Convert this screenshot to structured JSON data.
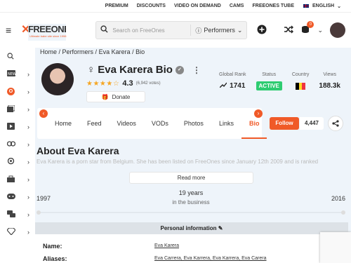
{
  "topbar": {
    "links": [
      "PREMIUM",
      "DISCOUNTS",
      "VIDEO ON DEMAND",
      "CAMS",
      "FREEONES TUBE"
    ],
    "language": "ENGLISH"
  },
  "header": {
    "logo_text": "FREEONES",
    "logo_tagline": "Ultimate babe site since 1998",
    "search_placeholder": "Search on FreeOnes",
    "search_filter": "Performers",
    "notification_count": "0"
  },
  "sidebar": {
    "items": [
      {
        "icon": "search-icon",
        "chevron": false
      },
      {
        "icon": "new-icon",
        "chevron": true
      },
      {
        "icon": "freeones-icon",
        "chevron": true
      },
      {
        "icon": "photos-icon",
        "chevron": true
      },
      {
        "icon": "videos-icon",
        "chevron": true
      },
      {
        "icon": "links-icon",
        "chevron": true
      },
      {
        "icon": "cams-icon",
        "chevron": true
      },
      {
        "icon": "shop-icon",
        "chevron": true
      },
      {
        "icon": "games-icon",
        "chevron": true
      },
      {
        "icon": "forum-icon",
        "chevron": true
      },
      {
        "icon": "diamond-icon",
        "chevron": true
      }
    ]
  },
  "breadcrumb": [
    "Home",
    "Performers",
    "Eva Karera",
    "Bio"
  ],
  "profile": {
    "name": "Eva Karera Bio",
    "rating": "4.3",
    "votes": "(6,942 votes)",
    "donate_label": "Donate",
    "stars": "★★★★☆"
  },
  "stats": {
    "global_rank_label": "Global Rank",
    "global_rank": "1741",
    "status_label": "Status",
    "status": "ACTIVE",
    "country_label": "Country",
    "views_label": "Views",
    "views": "188.3k"
  },
  "tabs": [
    "Home",
    "Feed",
    "Videos",
    "VODs",
    "Photos",
    "Links",
    "Bio"
  ],
  "follow": {
    "label": "Follow",
    "count": "4,447"
  },
  "about": {
    "title": "About Eva Karera",
    "text": "Eva Karera is a porn star from Belgium. She has been listed on FreeOnes since January 12th 2009 and is ranked",
    "read_more": "Read more"
  },
  "career": {
    "start": "1997",
    "end": "2016",
    "years": "19 years",
    "subtitle": "in the business"
  },
  "personal_info": {
    "title": "Personal information",
    "rows": [
      {
        "label": "Name:",
        "value": "Eva Karera"
      },
      {
        "label": "Aliases:",
        "value": "Eva Carrera, Eva Karrera, Eva Karrera, Eva Carera"
      }
    ]
  },
  "colors": {
    "accent": "#f05a28",
    "active": "#2ecc71",
    "background": "#eef4fa"
  }
}
